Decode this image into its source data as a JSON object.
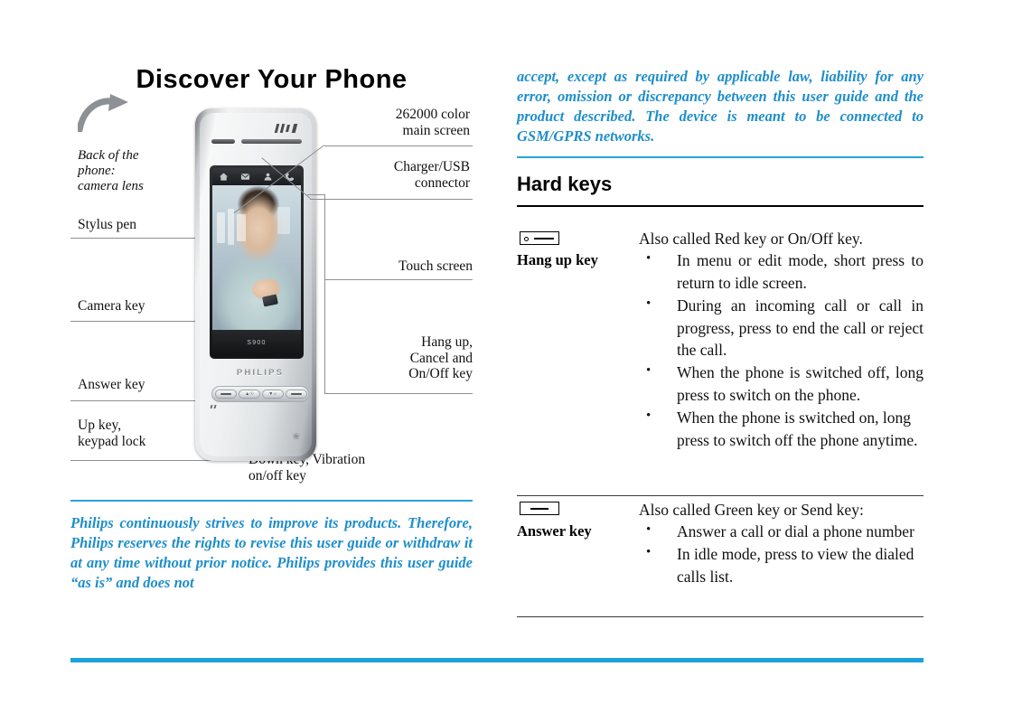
{
  "page": {
    "title": "Discover Your Phone",
    "accent_blue": "#1ba2db",
    "text_blue": "#1f8ec9"
  },
  "phone": {
    "brand": "PHILIPS",
    "model_caption": "S900",
    "toolbar_icons": [
      "home-icon",
      "mail-icon",
      "contact-icon",
      "call-icon"
    ],
    "status_icon": "signal-icon",
    "bluetooth_icon": "bluetooth-icon"
  },
  "callouts": {
    "left": [
      {
        "id": "back-of-phone",
        "text": "Back of the\nphone:\ncamera lens",
        "style": "italic"
      },
      {
        "id": "stylus-pen",
        "text": "Stylus pen",
        "style": "roman"
      },
      {
        "id": "camera-key",
        "text": "Camera key",
        "style": "roman"
      },
      {
        "id": "answer-key",
        "text": "Answer key",
        "style": "roman"
      },
      {
        "id": "up-key",
        "text": "Up key,\nkeypad lock",
        "style": "roman"
      }
    ],
    "right": [
      {
        "id": "main-screen",
        "text": "262000 color\nmain screen"
      },
      {
        "id": "charger-usb",
        "text": "Charger/USB\nconnector"
      },
      {
        "id": "touch-screen",
        "text": "Touch screen"
      },
      {
        "id": "hang-up-cancel",
        "text": "Hang up,\nCancel and\nOn/Off key"
      }
    ],
    "bottom": [
      {
        "id": "down-key",
        "text": "Down key, Vibration\non/off key"
      }
    ]
  },
  "left_column": {
    "notice_paragraph": "Philips continuously strives to improve its products. Therefore, Philips reserves the rights to revise this user guide or withdraw it at any time without prior notice. Philips provides this user guide “as is” and does not"
  },
  "right_column": {
    "notice_paragraph": "accept, except as required by applicable law, liability for any error, omission or discrepancy between this user guide and the product described. The device is meant to be connected to GSM/GPRS networks.",
    "section_title": "Hard keys",
    "rows": [
      {
        "key_name": "Hang up key",
        "icon": "hang-up-key-icon",
        "lead": "Also called Red key or On/Off key.",
        "bullets": [
          "In menu or edit mode, short press to return to idle screen.",
          "During an incoming call or call in progress, press to end the call or reject the call.",
          "When the phone is switched off, long press to switch on the phone.",
          "When the phone is switched on, long press to switch off the phone anytime."
        ]
      },
      {
        "key_name": "Answer key",
        "icon": "answer-key-icon",
        "lead": "Also called Green key or Send key:",
        "bullets": [
          "Answer a call or dial a phone number",
          "In idle mode, press to view the dialed calls list."
        ]
      }
    ]
  }
}
